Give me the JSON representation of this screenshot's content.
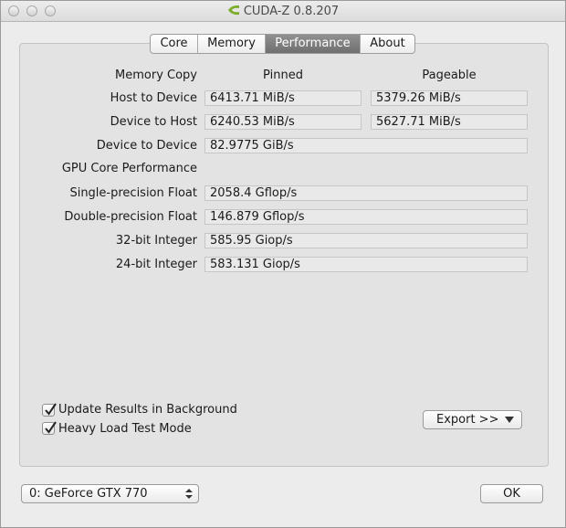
{
  "window": {
    "title": "CUDA-Z 0.8.207",
    "icons": {
      "close": "close-button",
      "minimize": "minimize-button",
      "zoom": "zoom-button",
      "logo": "cuda-z-logo-icon"
    }
  },
  "tabs": [
    {
      "label": "Core",
      "active": false
    },
    {
      "label": "Memory",
      "active": false
    },
    {
      "label": "Performance",
      "active": true
    },
    {
      "label": "About",
      "active": false
    }
  ],
  "memory": {
    "section_label": "Memory Copy",
    "col_pinned": "Pinned",
    "col_pageable": "Pageable",
    "rows": [
      {
        "label": "Host to Device",
        "pinned": "6413.71 MiB/s",
        "pageable": "5379.26 MiB/s"
      },
      {
        "label": "Device to Host",
        "pinned": "6240.53 MiB/s",
        "pageable": "5627.71 MiB/s"
      },
      {
        "label": "Device to Device",
        "pinned": "82.9775 GiB/s"
      }
    ]
  },
  "gpu": {
    "section_label": "GPU Core Performance",
    "rows": [
      {
        "label": "Single-precision Float",
        "value": "2058.4 Gflop/s"
      },
      {
        "label": "Double-precision Float",
        "value": "146.879 Gflop/s"
      },
      {
        "label": "32-bit Integer",
        "value": "585.95 Giop/s"
      },
      {
        "label": "24-bit Integer",
        "value": "583.131 Giop/s"
      }
    ]
  },
  "options": {
    "update_bg": {
      "label": "Update Results in Background",
      "checked": true
    },
    "heavy_load": {
      "label": "Heavy Load Test Mode",
      "checked": true
    },
    "export_label": "Export >>"
  },
  "footer": {
    "device_selected": "0: GeForce GTX 770",
    "ok_label": "OK"
  }
}
